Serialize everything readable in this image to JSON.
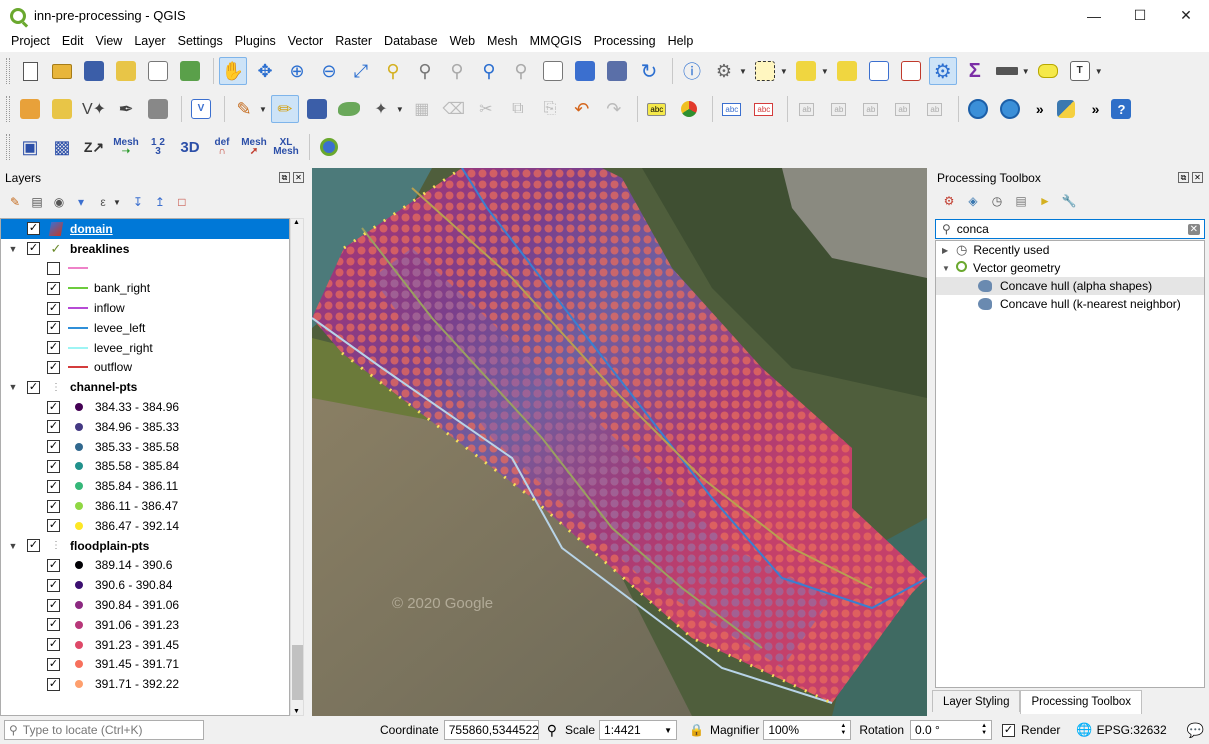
{
  "window": {
    "title": "inn-pre-processing - QGIS"
  },
  "menu": [
    "Project",
    "Edit",
    "View",
    "Layer",
    "Settings",
    "Plugins",
    "Vector",
    "Raster",
    "Database",
    "Web",
    "Mesh",
    "MMQGIS",
    "Processing",
    "Help"
  ],
  "toolbar3": {
    "mesh_label": "Mesh",
    "num_label": "1 2\n3",
    "threed_label": "3D",
    "def_label": "def",
    "mesh2_label": "Mesh",
    "xl_label": "XL\nMesh"
  },
  "layers_panel": {
    "title": "Layers",
    "items": [
      {
        "name": "domain",
        "type": "layer",
        "checked": true,
        "selected": true
      },
      {
        "name": "breaklines",
        "type": "group",
        "checked": true
      },
      {
        "label": "",
        "color": "#ee82c8",
        "kind": "line",
        "checked": false
      },
      {
        "label": "bank_right",
        "color": "#6ccc3c",
        "kind": "line",
        "checked": true
      },
      {
        "label": "inflow",
        "color": "#b64ad6",
        "kind": "line",
        "checked": true
      },
      {
        "label": "levee_left",
        "color": "#2f8fd8",
        "kind": "line",
        "checked": true
      },
      {
        "label": "levee_right",
        "color": "#9ef4f4",
        "kind": "line",
        "checked": true
      },
      {
        "label": "outflow",
        "color": "#d43c3c",
        "kind": "line",
        "checked": true
      },
      {
        "name": "channel-pts",
        "type": "group",
        "checked": true
      },
      {
        "label": "384.33 - 384.96",
        "color": "#440154",
        "kind": "point",
        "checked": true
      },
      {
        "label": "384.96 - 385.33",
        "color": "#443983",
        "kind": "point",
        "checked": true
      },
      {
        "label": "385.33 - 385.58",
        "color": "#31688e",
        "kind": "point",
        "checked": true
      },
      {
        "label": "385.58 - 385.84",
        "color": "#21918c",
        "kind": "point",
        "checked": true
      },
      {
        "label": "385.84 - 386.11",
        "color": "#35b779",
        "kind": "point",
        "checked": true
      },
      {
        "label": "386.11 - 386.47",
        "color": "#90d743",
        "kind": "point",
        "checked": true
      },
      {
        "label": "386.47 - 392.14",
        "color": "#fde725",
        "kind": "point",
        "checked": true
      },
      {
        "name": "floodplain-pts",
        "type": "group",
        "checked": true
      },
      {
        "label": "389.14 - 390.6",
        "color": "#000004",
        "kind": "point",
        "checked": true
      },
      {
        "label": "390.6 - 390.84",
        "color": "#3b0f70",
        "kind": "point",
        "checked": true
      },
      {
        "label": "390.84 - 391.06",
        "color": "#8c2981",
        "kind": "point",
        "checked": true
      },
      {
        "label": "391.06 - 391.23",
        "color": "#b73779",
        "kind": "point",
        "checked": true
      },
      {
        "label": "391.23 - 391.45",
        "color": "#de4968",
        "kind": "point",
        "checked": true
      },
      {
        "label": "391.45 - 391.71",
        "color": "#f7705c",
        "kind": "point",
        "checked": true
      },
      {
        "label": "391.71 - 392.22",
        "color": "#fe9f6d",
        "kind": "point",
        "checked": true
      }
    ]
  },
  "map": {
    "watermark": "© 2020 Google"
  },
  "toolbox": {
    "title": "Processing Toolbox",
    "search_value": "conca",
    "tree": [
      {
        "label": "Recently used",
        "level": 0,
        "expanded": false
      },
      {
        "label": "Vector geometry",
        "level": 0,
        "expanded": true
      },
      {
        "label": "Concave hull (alpha shapes)",
        "level": 1,
        "highlighted": true
      },
      {
        "label": "Concave hull (k-nearest neighbor)",
        "level": 1,
        "highlighted": false
      }
    ],
    "tabs": [
      "Layer Styling",
      "Processing Toolbox"
    ],
    "active_tab": "Processing Toolbox"
  },
  "statusbar": {
    "locate_placeholder": "Type to locate (Ctrl+K)",
    "coordinate_label": "Coordinate",
    "coordinate_value": "755860,5344522",
    "scale_label": "Scale",
    "scale_value": "1:4421",
    "magnifier_label": "Magnifier",
    "magnifier_value": "100%",
    "rotation_label": "Rotation",
    "rotation_value": "0.0 °",
    "render_label": "Render",
    "render_checked": true,
    "crs": "EPSG:32632"
  }
}
